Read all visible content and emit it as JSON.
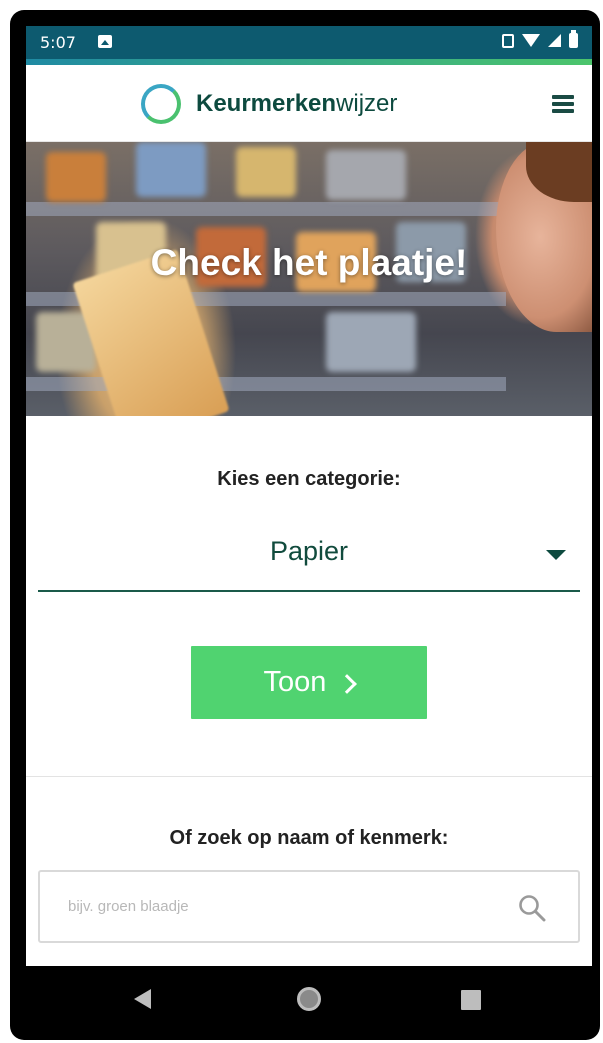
{
  "status_bar": {
    "time": "5:07"
  },
  "header": {
    "logo_bold": "Keurmerken",
    "logo_light": "wijzer"
  },
  "hero": {
    "title": "Check het plaatje!"
  },
  "category": {
    "label": "Kies een categorie:",
    "selected": "Papier"
  },
  "show_button": {
    "label": "Toon"
  },
  "search": {
    "label": "Of zoek op naam of kenmerk:",
    "placeholder": "bijv. groen blaadje"
  },
  "colors": {
    "status_bar": "#0d5a6f",
    "button": "#50d370",
    "text_dark_green": "#114b3d"
  },
  "icons": [
    "photo-icon",
    "vibrate-icon",
    "wifi-icon",
    "signal-icon",
    "battery-icon",
    "logo-ring-icon",
    "menu-icon",
    "chevron-down-icon",
    "chevron-right-icon",
    "search-icon",
    "nav-back-icon",
    "nav-home-icon",
    "nav-recent-icon"
  ]
}
